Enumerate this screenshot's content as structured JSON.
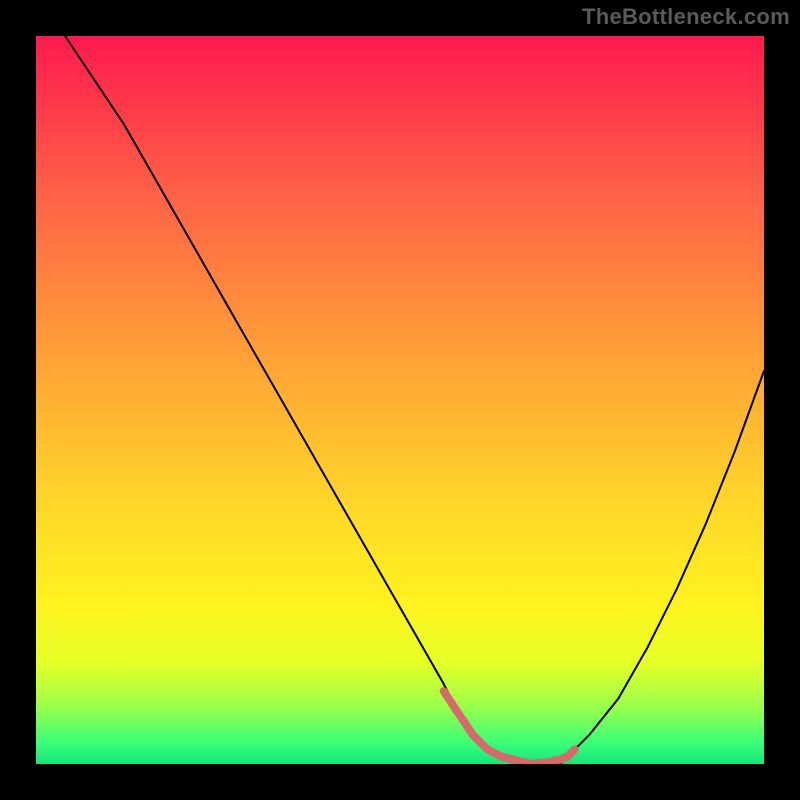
{
  "watermark": "TheBottleneck.com",
  "chart_data": {
    "type": "line",
    "title": "",
    "xlabel": "",
    "ylabel": "",
    "xlim": [
      0,
      100
    ],
    "ylim": [
      0,
      100
    ],
    "grid": false,
    "legend_position": "none",
    "annotations": [],
    "background_gradient_stops": [
      {
        "pos": 0.0,
        "color": "#ff1a4d"
      },
      {
        "pos": 0.22,
        "color": "#ff6247"
      },
      {
        "pos": 0.5,
        "color": "#ffb132"
      },
      {
        "pos": 0.78,
        "color": "#fff21e"
      },
      {
        "pos": 0.92,
        "color": "#9cff4a"
      },
      {
        "pos": 1.0,
        "color": "#15e57a"
      }
    ],
    "series": [
      {
        "name": "bottleneck-curve",
        "color": "#000000",
        "width": 2,
        "x": [
          4,
          8,
          12,
          16,
          20,
          24,
          28,
          32,
          36,
          40,
          44,
          48,
          52,
          56,
          58,
          60,
          64,
          68,
          72,
          73,
          76,
          80,
          84,
          88,
          92,
          96,
          100
        ],
        "y": [
          100,
          94,
          88,
          81,
          74,
          67,
          60,
          53,
          46,
          39,
          32,
          25,
          18,
          11,
          7,
          4,
          1,
          0,
          0,
          1,
          4,
          9,
          16,
          24,
          33,
          43,
          54
        ]
      },
      {
        "name": "optimal-band",
        "color": "#d46a6a",
        "width": 8,
        "x": [
          56,
          58,
          60,
          62,
          64,
          66,
          68,
          70,
          72,
          73,
          74
        ],
        "y": [
          10,
          7,
          4,
          2,
          1,
          0.5,
          0,
          0.2,
          0.6,
          1,
          2
        ]
      }
    ]
  }
}
